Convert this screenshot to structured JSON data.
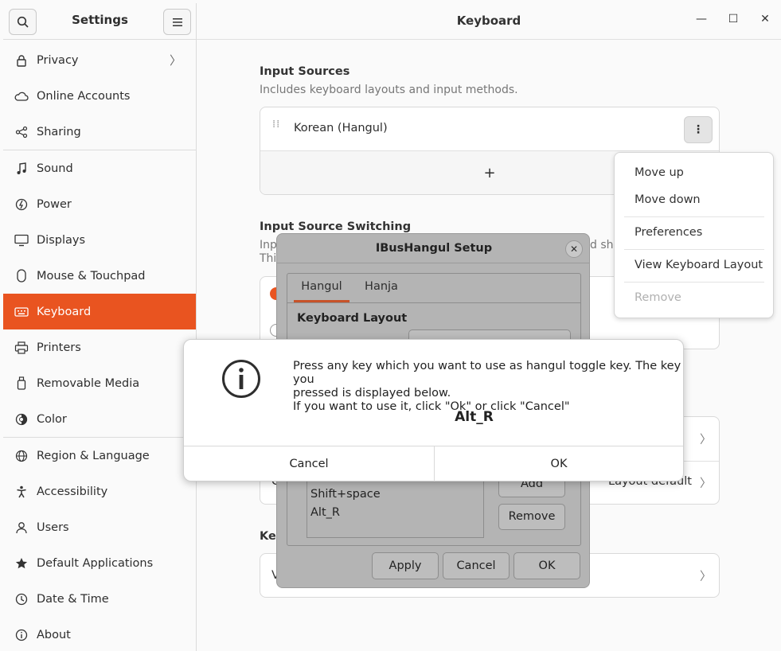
{
  "sidebar": {
    "title": "Settings",
    "items": [
      {
        "label": "Privacy",
        "icon": "lock-icon"
      },
      {
        "label": "Online Accounts",
        "icon": "cloud-icon"
      },
      {
        "label": "Sharing",
        "icon": "share-icon"
      },
      {
        "label": "Sound",
        "icon": "music-note-icon"
      },
      {
        "label": "Power",
        "icon": "power-icon"
      },
      {
        "label": "Displays",
        "icon": "display-icon"
      },
      {
        "label": "Mouse & Touchpad",
        "icon": "mouse-icon"
      },
      {
        "label": "Keyboard",
        "icon": "keyboard-icon"
      },
      {
        "label": "Printers",
        "icon": "printer-icon"
      },
      {
        "label": "Removable Media",
        "icon": "usb-drive-icon"
      },
      {
        "label": "Color",
        "icon": "color-icon"
      },
      {
        "label": "Region & Language",
        "icon": "globe-icon"
      },
      {
        "label": "Accessibility",
        "icon": "accessibility-icon"
      },
      {
        "label": "Users",
        "icon": "user-icon"
      },
      {
        "label": "Default Applications",
        "icon": "star-icon"
      },
      {
        "label": "Date & Time",
        "icon": "clock-icon"
      },
      {
        "label": "About",
        "icon": "info-icon"
      }
    ]
  },
  "header": {
    "title": "Keyboard"
  },
  "input_sources": {
    "title": "Input Sources",
    "subtitle": "Includes keyboard layouts and input methods.",
    "source_name": "Korean (Hangul)",
    "add_label": "+"
  },
  "switching": {
    "title": "Input Source Switching",
    "desc_line1_start": "Inp",
    "desc_line1_end": "d sho",
    "desc_line2_start": "This"
  },
  "shortcuts": {
    "row2_value": "Layout default",
    "row1_value_fragment": "t",
    "row2_label_fragment": "C",
    "section_fragment": "Key",
    "row3_fragment": "V"
  },
  "popover": {
    "items": [
      "Move up",
      "Move down",
      "Preferences",
      "View Keyboard Layout",
      "Remove"
    ]
  },
  "ibus": {
    "title": "IBusHangul Setup",
    "tabs": [
      "Hangul",
      "Hanja"
    ],
    "group_title": "Keyboard Layout",
    "key_list": [
      "Shift+space",
      "Alt_R"
    ],
    "add_label": "Add",
    "remove_label": "Remove",
    "apply_label": "Apply",
    "cancel_label": "Cancel",
    "ok_label": "OK"
  },
  "alert": {
    "message_line1": "Press any key which you want to use as hangul toggle key. The key you",
    "message_line2": "pressed is displayed below.",
    "message_line3": "If you want to use it, click \"Ok\" or click \"Cancel\"",
    "key": "Alt_R",
    "cancel_label": "Cancel",
    "ok_label": "OK"
  },
  "colors": {
    "accent": "#e95420"
  }
}
